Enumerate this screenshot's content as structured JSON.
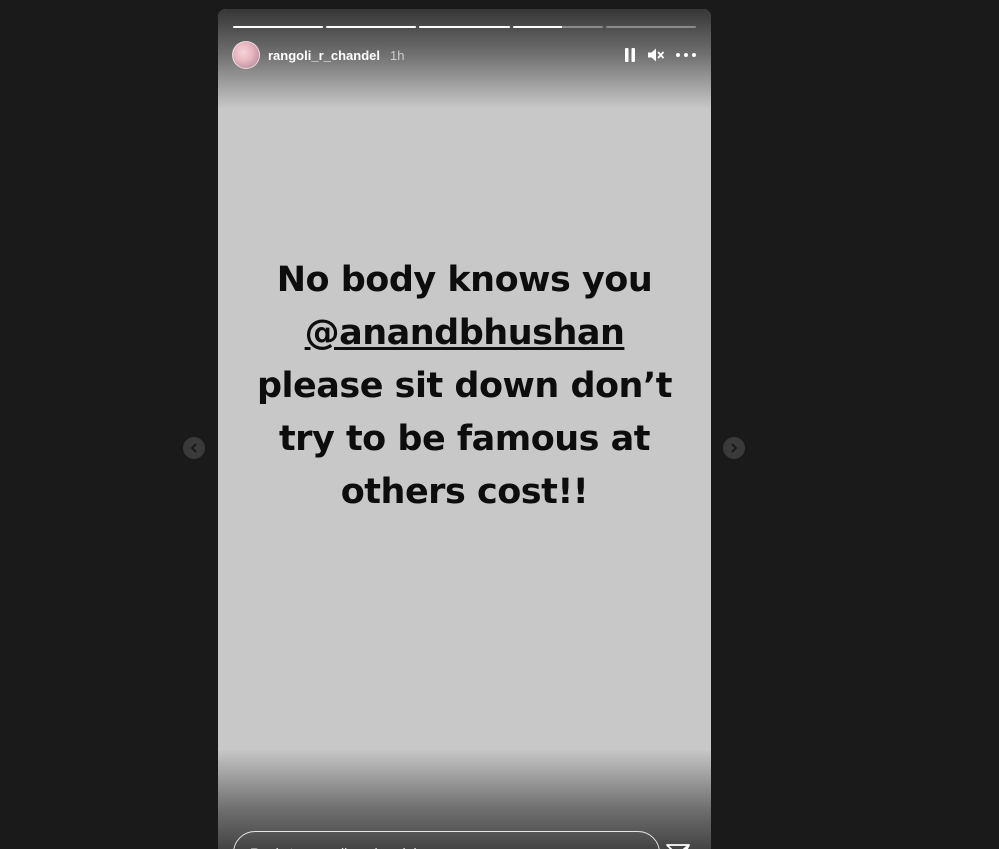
{
  "story": {
    "username": "rangoli_r_chandel",
    "time_ago": "1h",
    "progress_segments": [
      1,
      1,
      1,
      0.55,
      0
    ],
    "text_lines": {
      "line1": "No body knows you",
      "mention": "@anandbhushan",
      "line3": "please sit down don’t",
      "line4": "try to be famous at",
      "line5": "others cost!!"
    },
    "background_color": "#c8c8c8",
    "text_color": "#0d0d0d"
  },
  "controls": {
    "pause_icon": "pause-icon",
    "mute_icon": "speaker-muted-icon",
    "more_icon": "more-options-icon"
  },
  "reply": {
    "placeholder": "Reply to rangoli_r_chandel..."
  },
  "navigation": {
    "prev_icon": "chevron-left-icon",
    "next_icon": "chevron-right-icon"
  }
}
